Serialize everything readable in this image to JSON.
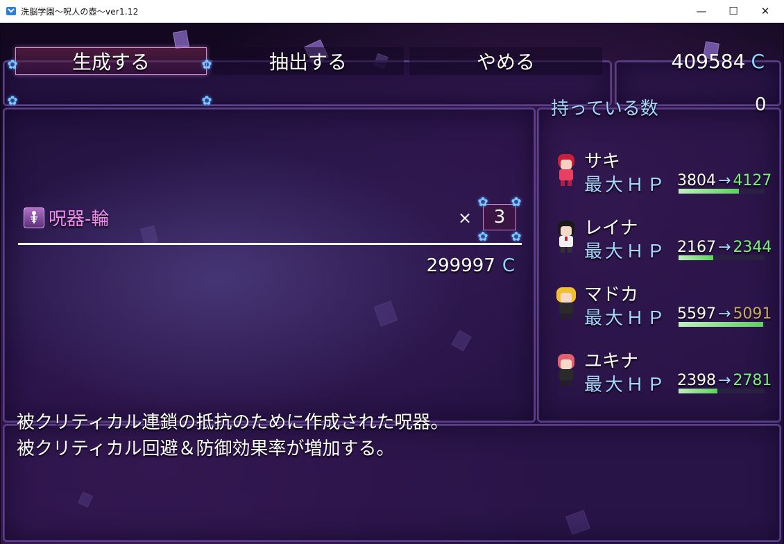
{
  "window": {
    "title": "洗脳学園～呪人の壺～ver1.12",
    "minimize": "—",
    "maximize": "☐",
    "close": "✕"
  },
  "commands": [
    {
      "label": "生成する",
      "selected": true
    },
    {
      "label": "抽出する",
      "selected": false
    },
    {
      "label": "やめる",
      "selected": false
    }
  ],
  "gold": {
    "value": "409584",
    "unit": "C"
  },
  "item": {
    "name": "呪器-輪",
    "times": "×",
    "quantity": "3",
    "total": "299997",
    "unit": "C"
  },
  "status": {
    "own_label": "持っている数",
    "own_value": "0",
    "actors": [
      {
        "name": "サキ",
        "hp_label": "最大ＨＰ",
        "hp_old": "3804",
        "arrow": "→",
        "hp_new": "4127",
        "change": "up",
        "hp_fill": 0.7
      },
      {
        "name": "レイナ",
        "hp_label": "最大ＨＰ",
        "hp_old": "2167",
        "arrow": "→",
        "hp_new": "2344",
        "change": "up",
        "hp_fill": 0.4
      },
      {
        "name": "マドカ",
        "hp_label": "最大ＨＰ",
        "hp_old": "5597",
        "arrow": "→",
        "hp_new": "5091",
        "change": "down",
        "hp_fill": 0.98
      },
      {
        "name": "ユキナ",
        "hp_label": "最大ＨＰ",
        "hp_old": "2398",
        "arrow": "→",
        "hp_new": "2781",
        "change": "up",
        "hp_fill": 0.45
      }
    ]
  },
  "help": {
    "line1": "被クリティカル連鎖の抵抗のために作成された呪器。",
    "line2": "被クリティカル回避＆防御効果率が増加する。"
  }
}
